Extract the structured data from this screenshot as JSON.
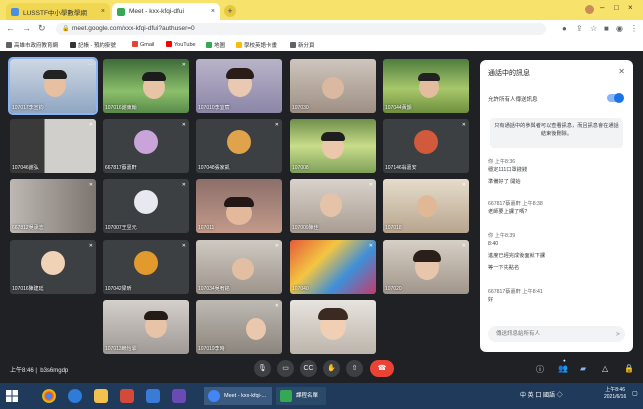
{
  "browser": {
    "tabs": [
      {
        "label": "LUSSTF中小學數學網",
        "active": false
      },
      {
        "label": "Meet - kxx-kfqi-dfui",
        "active": true
      }
    ],
    "url": "meet.google.com/xxx-kfqi-dfui?authuser=0",
    "bookmarks": [
      "高雄市政府教育網",
      "記帳 - 預約掛號",
      "Gmail",
      "YouTube",
      "地圖",
      "學校英語卡畫",
      "新分頁"
    ]
  },
  "meeting": {
    "participants": [
      {
        "name": "107017李宣鈞"
      },
      {
        "name": "107016謝東翰"
      },
      {
        "name": "107010李宜宸"
      },
      {
        "name": "107030"
      },
      {
        "name": "107044黃韻"
      },
      {
        "name": "107046謝弘"
      },
      {
        "name": "667817蔡嘉軒"
      },
      {
        "name": "107048張家凱"
      },
      {
        "name": "107008"
      },
      {
        "name": "107146翁嘉安"
      },
      {
        "name": "667812吳承志"
      },
      {
        "name": "107007王昱元"
      },
      {
        "name": "107011"
      },
      {
        "name": "107009陳佳"
      },
      {
        "name": "107018"
      },
      {
        "name": "107016陳建廷"
      },
      {
        "name": "107042梁昕"
      },
      {
        "name": "107034吳宥銘"
      },
      {
        "name": "107040"
      },
      {
        "name": "107020"
      },
      {
        "name": "107013賴怡霏"
      },
      {
        "name": "107019李時"
      },
      {
        "name": ""
      }
    ],
    "time": "上午8:46",
    "code": "b3s6mgdp"
  },
  "chat": {
    "title": "通話中的訊息",
    "toggle_label": "允許所有人傳送訊息",
    "notice": "只有通話中的參與者可以查看訊息，而且訊息會在通話結束後刪除。",
    "messages": [
      {
        "sender": "你  上午8:36",
        "lines": [
          "穩定111口罩錢錢",
          "準備好了  開始"
        ]
      },
      {
        "sender": "667817蔡嘉軒  上午8:38",
        "lines": [
          "老師要上課了嗎?"
        ]
      },
      {
        "sender": "你  上午8:39",
        "lines": [
          "8:40",
          "進度已經完成後面就下課",
          "等一下先點名"
        ]
      },
      {
        "sender": "667817蔡嘉軒  上午8:41",
        "lines": [
          "好"
        ]
      }
    ],
    "input_placeholder": "傳送訊息給所有人"
  },
  "taskbar": {
    "windows": [
      "Meet - kxx-kfqi-...",
      "課程名單"
    ],
    "tray": "中 英 口 國語 ◇",
    "time": "上午8:46",
    "date": "2021/6/16"
  }
}
